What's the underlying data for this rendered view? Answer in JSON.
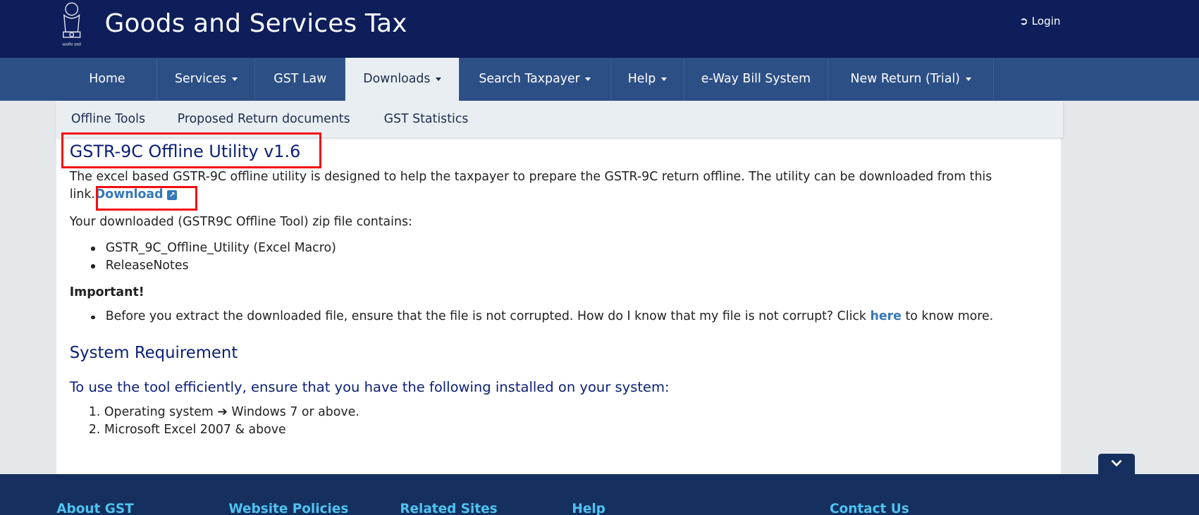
{
  "header": {
    "title": "Goods and Services Tax",
    "login_label": "Login",
    "emblem_caption": "सत्यमेव जयते"
  },
  "nav": {
    "items": [
      {
        "label": "Home",
        "dropdown": false
      },
      {
        "label": "Services",
        "dropdown": true
      },
      {
        "label": "GST Law",
        "dropdown": false
      },
      {
        "label": "Downloads",
        "dropdown": true,
        "active": true
      },
      {
        "label": "Search Taxpayer",
        "dropdown": true
      },
      {
        "label": "Help",
        "dropdown": true
      },
      {
        "label": "e-Way Bill System",
        "dropdown": false
      },
      {
        "label": "New Return (Trial)",
        "dropdown": true
      }
    ]
  },
  "submenu": {
    "items": [
      "Offline Tools",
      "Proposed Return documents",
      "GST Statistics"
    ]
  },
  "main": {
    "title": "GSTR-9C Offline Utility v1.6",
    "intro_line1": "The excel based GSTR-9C offline utility is designed to help the taxpayer to prepare the GSTR-9C return offline. The utility can be downloaded from this",
    "intro_line2": "link.",
    "download_link": "Download",
    "zip_intro": "Your downloaded (GSTR9C Offline Tool) zip file contains:",
    "zip_items": [
      "GSTR_9C_Offline_Utility (Excel Macro)",
      "ReleaseNotes"
    ],
    "important_label": "Important!",
    "important_text": "Before you extract the downloaded file, ensure that the file is not corrupted. How do I know that my file is not corrupt? Click",
    "important_link": "here",
    "important_suffix": "to know more.",
    "sysreq_title": "System Requirement",
    "sysreq_intro": "To use the tool efficiently, ensure that you have the following installed on your system:",
    "sysreq_items": [
      {
        "num": "1.",
        "pre": "Operating system",
        "arrow": "➔",
        "post": "Windows 7 or above."
      },
      {
        "num": "2.",
        "pre": "Microsoft Excel 2007 & above"
      }
    ]
  },
  "footer": {
    "headings": [
      "About GST",
      "Website Policies",
      "Related Sites",
      "Help",
      "Contact Us"
    ]
  },
  "colors": {
    "header": "#0d1e5a",
    "nav": "#2c4f86",
    "footer": "#15305f",
    "link": "#3677b8",
    "highlight": "#f20d0d",
    "heading": "#0b1f74"
  }
}
